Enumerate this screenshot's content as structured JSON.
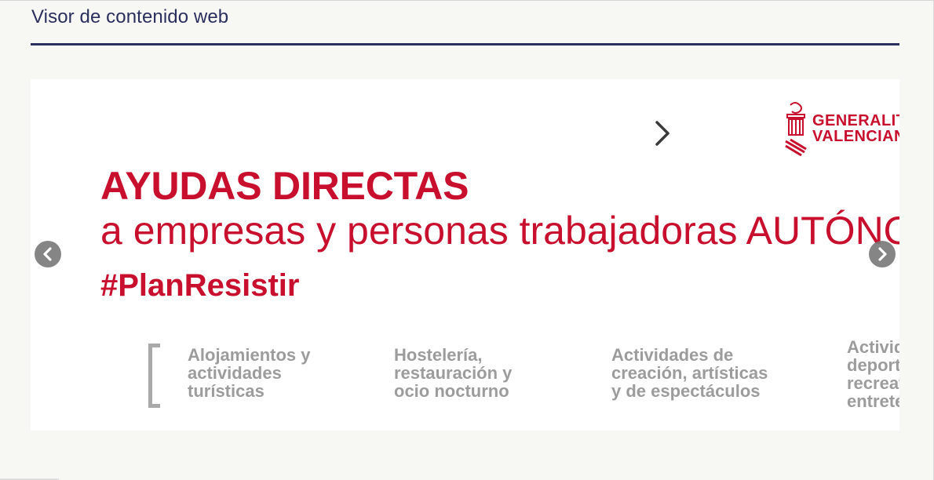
{
  "portlet": {
    "title": "Visor de contenido web"
  },
  "banner": {
    "logo": {
      "line1": "GENERALITAT",
      "line2": "VALENCIANA"
    },
    "headline": "AYUDAS DIRECTAS",
    "subline": "a empresas y personas trabajadoras AUTÓNOMAS",
    "hashtag": "#PlanResistir",
    "categories": [
      {
        "lines": [
          "Alojamientos y",
          "actividades",
          "turísticas"
        ]
      },
      {
        "lines": [
          "Hostelería,",
          "restauración y",
          "ocio nocturno"
        ]
      },
      {
        "lines": [
          "Actividades de",
          "creación, artísticas",
          "y de espectáculos"
        ]
      },
      {
        "lines": [
          "Actividades",
          "deportivas,",
          "recreativas y de",
          "entretenimiento"
        ]
      }
    ]
  },
  "colors": {
    "brand_red": "#c8102e",
    "title_navy": "#2a2f5e",
    "category_gray": "#9c9c9c"
  },
  "icons": {
    "prev": "chevron-left-circle-icon",
    "next": "chevron-right-circle-icon",
    "slide_next": "chevron-right-icon",
    "logo": "generalitat-crest-icon"
  }
}
